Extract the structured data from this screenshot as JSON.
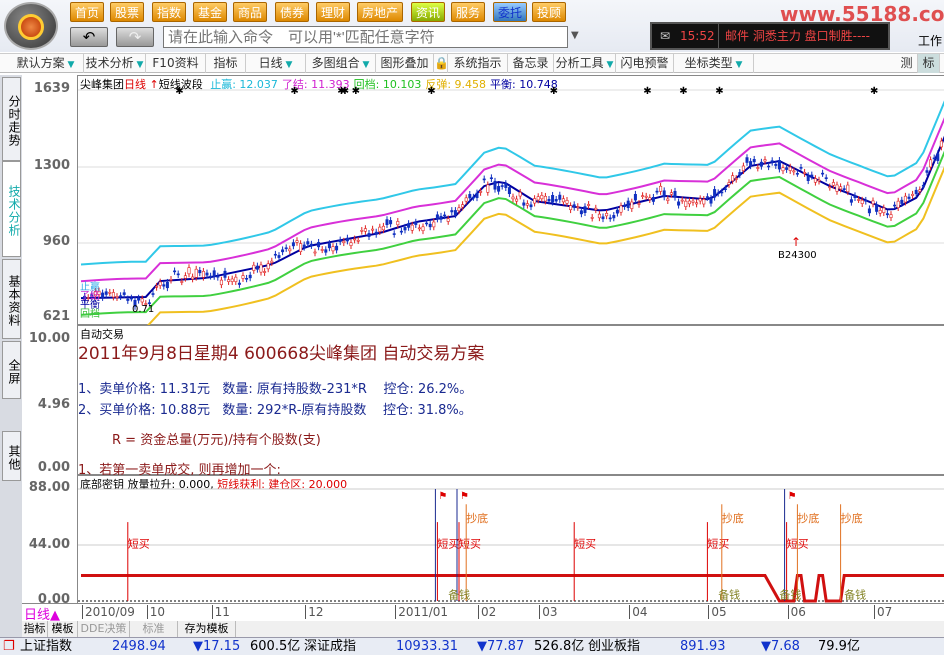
{
  "nav": [
    "首页",
    "股票",
    "指数",
    "基金",
    "商品",
    "债券",
    "理财",
    "房地产",
    "资讯",
    "服务",
    "委托",
    "投顾"
  ],
  "command": {
    "placeholder": "请在此输入命令　可以用'*'匹配任意字符"
  },
  "ticker": {
    "time": "15:52",
    "text": "邮件  洞悉主力 盘口制胜----"
  },
  "watermark": "www.55188.com",
  "workspace": "工作",
  "toolbar": [
    {
      "label": "默认方案",
      "dd": true
    },
    {
      "label": "技术分析",
      "dd": true
    },
    {
      "label": "F10资料"
    },
    {
      "label": "指标"
    },
    {
      "label": "日线",
      "dd": true
    },
    {
      "label": "多图组合",
      "dd": true
    },
    {
      "label": "图形叠加"
    },
    {
      "label": "🔒"
    },
    {
      "label": "系统指示"
    },
    {
      "label": "备忘录"
    },
    {
      "label": "分析工具",
      "dd": true
    },
    {
      "label": "闪电预警"
    },
    {
      "label": "坐标类型",
      "dd": true
    }
  ],
  "toolbar_right": [
    "测",
    "标"
  ],
  "left_tabs": [
    "分时走势",
    "技术分析",
    "基本资料",
    "全屏",
    "其他"
  ],
  "price_pane": {
    "stock": "尖峰集团",
    "period": "日线",
    "indicator": "短线波段",
    "legend": [
      {
        "label": "止赢: 12.037",
        "color": "#1bb8d8"
      },
      {
        "label": "了结: 11.393",
        "color": "#d020d0"
      },
      {
        "label": "回档: 10.103",
        "color": "#20c020"
      },
      {
        "label": "反弹: 9.458",
        "color": "#e0b000"
      },
      {
        "label": "平衡: 10.748",
        "color": "#0000a0"
      }
    ],
    "yticks": [
      "1639",
      "1300",
      "960",
      "621"
    ],
    "in_labels": [
      "止赢",
      "了结",
      "平衡",
      "回档"
    ],
    "low_label": "0.71",
    "mark_label": "B24300"
  },
  "auto_pane": {
    "title": "自动交易",
    "heading": "2011年9月8日星期4 600668尖峰集团 自动交易方案",
    "line1": "1、卖单价格: 11.31元   数量: 原有持股数-231*R    控仓: 26.2%。",
    "line2": "2、买单价格: 10.88元   数量: 292*R-原有持股数    控仓: 31.8%。",
    "formula": "R = 资金总量(万元)/持有个股数(支)",
    "line3": "1、若第一卖单成交, 则再增加一个:",
    "yticks": [
      "10.00",
      "4.96",
      "0.00"
    ]
  },
  "ind_pane": {
    "name": "底部密钥",
    "legend1": "放量拉升: 0.000,",
    "legend2": "短线获利: 建仓区: 20.000",
    "yticks": [
      "88.00",
      "44.00",
      "0.00"
    ]
  },
  "date_axis": {
    "period": "日线▲",
    "ticks": [
      "2010/09",
      "10",
      "11",
      "12",
      "2011/01",
      "02",
      "03",
      "04",
      "05",
      "06",
      "07"
    ]
  },
  "bottom_tabs": [
    "指标",
    "模板",
    "DDE决策",
    "标准",
    "存为模板"
  ],
  "status": [
    {
      "name": "上证指数",
      "value": "2498.94",
      "change": "▼17.15",
      "amount": "600.5亿"
    },
    {
      "name": "深证成指",
      "value": "10933.31",
      "change": "▼77.87",
      "amount": "526.8亿"
    },
    {
      "name": "创业板指",
      "value": "891.93",
      "change": "▼7.68",
      "amount": "79.9亿"
    }
  ],
  "chart_data": {
    "type": "line",
    "bars": 240,
    "ylim": [
      621,
      1639
    ],
    "tick_index": [
      0,
      18,
      36,
      62,
      87,
      110,
      127,
      152,
      174,
      196,
      220
    ],
    "balance_index": [
      0,
      18,
      22,
      35,
      53,
      63,
      83,
      93,
      104,
      112,
      117,
      126,
      145,
      162,
      175,
      186,
      194,
      208,
      216,
      225,
      233,
      240
    ],
    "balance": [
      710,
      715,
      786,
      800,
      860,
      942,
      1000,
      1050,
      1076,
      1210,
      1233,
      1143,
      1099,
      1166,
      1150,
      1300,
      1322,
      1210,
      1160,
      1099,
      1166,
      1434
    ],
    "band_offsets": {
      "stop_win": 150,
      "close": 75,
      "pullback": -75,
      "rebound": -145
    },
    "star_index": [
      27,
      59,
      72,
      73,
      76,
      97,
      131,
      157,
      167,
      177,
      220
    ],
    "signal_line_value": 20,
    "signals": [
      {
        "i": 13,
        "label": "短买",
        "color": "#d00"
      },
      {
        "i": 99,
        "label": "短买",
        "color": "#d00"
      },
      {
        "i": 105,
        "label": "短买",
        "color": "#d00"
      },
      {
        "i": 137,
        "label": "短买",
        "color": "#d00"
      },
      {
        "i": 174,
        "label": "短买",
        "color": "#d00"
      },
      {
        "i": 196,
        "label": "短买",
        "color": "#d00"
      },
      {
        "i": 107,
        "label": "抄底",
        "color": "#e07020"
      },
      {
        "i": 178,
        "label": "抄底",
        "color": "#e07020"
      },
      {
        "i": 199,
        "label": "抄底",
        "color": "#e07020"
      },
      {
        "i": 211,
        "label": "抄底",
        "color": "#e07020"
      }
    ],
    "money_labels": [
      {
        "i": 102,
        "label": "备钱"
      },
      {
        "i": 177,
        "label": "备钱"
      },
      {
        "i": 194,
        "label": "备钱"
      },
      {
        "i": 212,
        "label": "备钱"
      }
    ]
  }
}
